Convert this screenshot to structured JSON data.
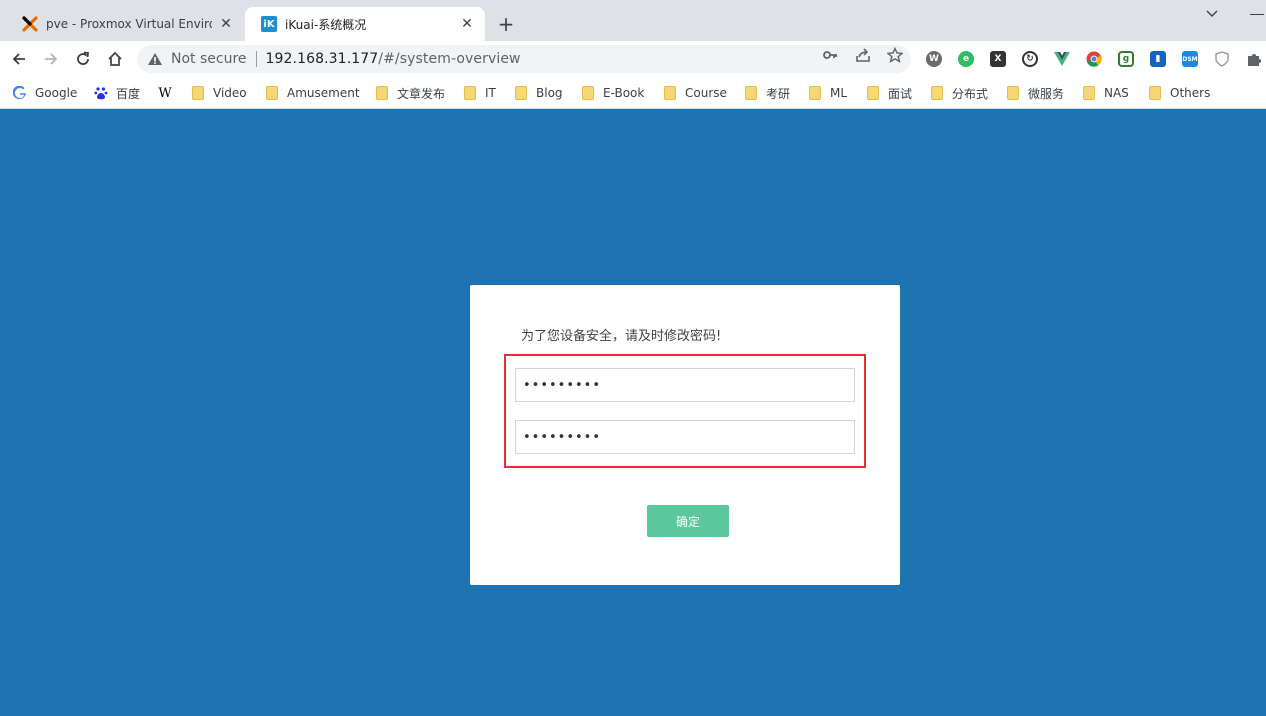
{
  "tabs": [
    {
      "title": "pve - Proxmox Virtual Environment",
      "favicon": "proxmox-icon",
      "active": false
    },
    {
      "title": "iKuai-系统概况",
      "favicon": "ikuai-icon",
      "favicon_text": "iK",
      "active": true
    }
  ],
  "address_bar": {
    "security_label": "Not secure",
    "url_host": "192.168.31.177",
    "url_path": "/#/system-overview"
  },
  "bookmarks": [
    {
      "label": "Google",
      "icon": "google-icon"
    },
    {
      "label": "百度",
      "icon": "baidu-icon"
    },
    {
      "label": "",
      "icon": "wikipedia-icon",
      "glyph": "W"
    },
    {
      "label": "Video",
      "icon": "folder-icon"
    },
    {
      "label": "Amusement",
      "icon": "folder-icon"
    },
    {
      "label": "文章发布",
      "icon": "folder-icon"
    },
    {
      "label": "IT",
      "icon": "folder-icon"
    },
    {
      "label": "Blog",
      "icon": "folder-icon"
    },
    {
      "label": "E-Book",
      "icon": "folder-icon"
    },
    {
      "label": "Course",
      "icon": "folder-icon"
    },
    {
      "label": "考研",
      "icon": "folder-icon"
    },
    {
      "label": "ML",
      "icon": "folder-icon"
    },
    {
      "label": "面试",
      "icon": "folder-icon"
    },
    {
      "label": "分布式",
      "icon": "folder-icon"
    },
    {
      "label": "微服务",
      "icon": "folder-icon"
    },
    {
      "label": "NAS",
      "icon": "folder-icon"
    },
    {
      "label": "Others",
      "icon": "folder-icon"
    }
  ],
  "dialog": {
    "message": "为了您设备安全，请及时修改密码!",
    "password_1": "•••••••••",
    "password_2": "•••••••••",
    "confirm_label": "确定"
  },
  "colors": {
    "page_background": "#1e74b1",
    "confirm_button": "#5bc89c",
    "highlight_border": "#e0303a"
  }
}
